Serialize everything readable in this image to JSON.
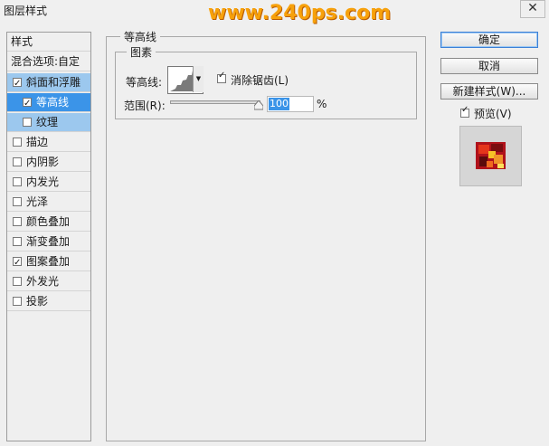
{
  "window": {
    "title": "图层样式",
    "watermark": "www.240ps.com",
    "close_glyph": "✕"
  },
  "left_panel": {
    "header": "样式",
    "blend_options": "混合选项:自定",
    "items": [
      {
        "label": "斜面和浮雕",
        "checked": true,
        "state": "selected-parent"
      },
      {
        "label": "等高线",
        "checked": true,
        "state": "active"
      },
      {
        "label": "纹理",
        "checked": false,
        "state": "selected-parent"
      },
      {
        "label": "描边",
        "checked": false
      },
      {
        "label": "内阴影",
        "checked": false
      },
      {
        "label": "内发光",
        "checked": false
      },
      {
        "label": "光泽",
        "checked": false
      },
      {
        "label": "颜色叠加",
        "checked": false
      },
      {
        "label": "渐变叠加",
        "checked": false
      },
      {
        "label": "图案叠加",
        "checked": true
      },
      {
        "label": "外发光",
        "checked": false
      },
      {
        "label": "投影",
        "checked": false
      }
    ]
  },
  "main": {
    "group_title": "等高线",
    "elements": {
      "title": "图素",
      "contour_label": "等高线:",
      "antialias_label": "消除锯齿(L)",
      "antialias_checked": true,
      "range_label": "范围(R):",
      "range_value": "100",
      "range_unit": "%"
    }
  },
  "buttons": {
    "ok": "确定",
    "cancel": "取消",
    "new_style": "新建样式(W)...",
    "preview_label": "预览(V)",
    "preview_checked": true
  },
  "colors": {
    "selected": "#3b94e8",
    "selected_light": "#9cc8ee",
    "watermark": "#f7a10b"
  }
}
